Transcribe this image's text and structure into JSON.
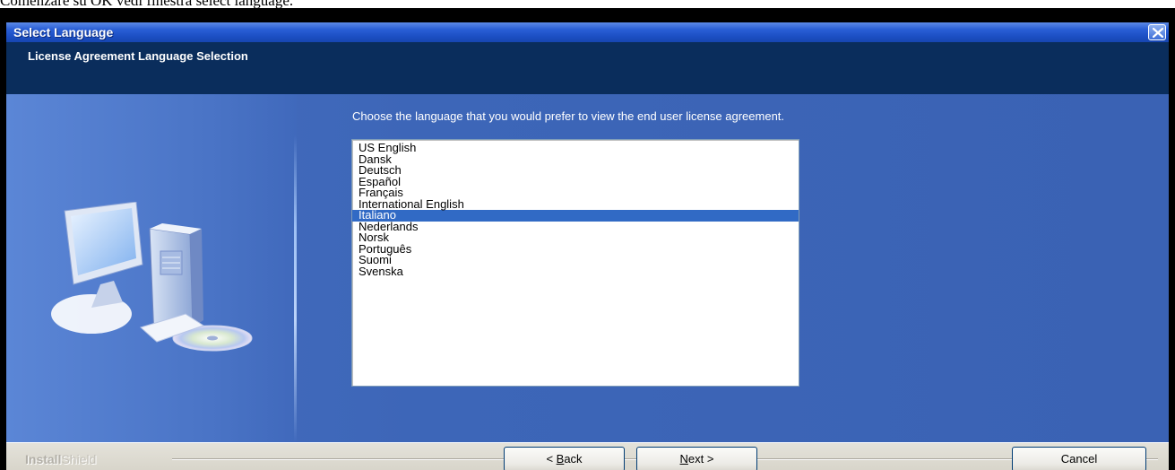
{
  "caption": "Comenzare su OK vedi finestra select language.",
  "window": {
    "title": "Select Language",
    "close_icon": "close-x-icon"
  },
  "header": {
    "subtitle": "License Agreement Language Selection"
  },
  "main": {
    "prompt": "Choose the language that you would prefer to view the end user license agreement.",
    "languages": [
      "US English",
      "Dansk",
      "Deutsch",
      "Español",
      "Français",
      "International English",
      "Italiano",
      "Nederlands",
      "Norsk",
      "Português",
      "Suomi",
      "Svenska"
    ],
    "selected_language": "Italiano"
  },
  "footer": {
    "brand_bold": "Install",
    "brand_light": "Shield",
    "back_hotkey": "B",
    "back_rest": "ack",
    "back_prefix": "< ",
    "next_hotkey": "N",
    "next_rest": "ext >",
    "cancel_label": "Cancel"
  },
  "colors": {
    "title_bar": "#2a5fd6",
    "header_band": "#0a2d5c",
    "panel": "#3b63b5",
    "selection": "#316ac5"
  }
}
